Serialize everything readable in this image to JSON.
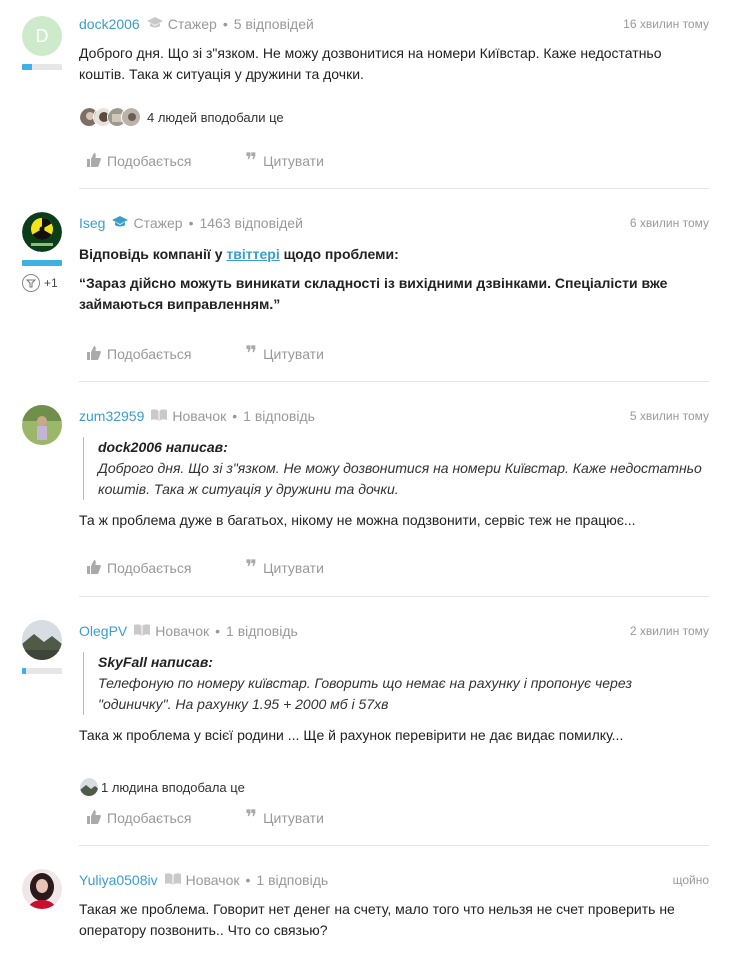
{
  "like_label": "Подобається",
  "quote_label": "Цитувати",
  "posts": [
    {
      "letter": "D",
      "username": "dock2006",
      "rank": "Стажер",
      "replies": "5 відповідей",
      "time": "16 хвилин тому",
      "rank_level": 0.25,
      "text": "Доброго дня. Що зі з\"язком. Не можу дозвонитися на номери Київстар. Каже недостатньо коштів. Така ж ситуація у дружини та дочки.",
      "likers_text": "4 людей вподобали це"
    },
    {
      "username": "Iseg",
      "rank": "Стажер",
      "replies": "1463 відповідей",
      "time": "6 хвилин тому",
      "rank_level": 1.0,
      "kudos": "+1",
      "line1_pre": "Відповідь компанії у ",
      "line1_link": "твіттері",
      "line1_post": " щодо проблеми:",
      "line2": "“Зараз дійсно можуть виникати складності із вихідними дзвінками. Спеціалісти вже займаються виправленням.”"
    },
    {
      "username": "zum32959",
      "rank": "Новачок",
      "replies": "1 відповідь",
      "time": "5 хвилин тому",
      "quote_author": "dock2006 написав:",
      "quote_text": "Доброго дня. Що зі з\"язком. Не можу дозвонитися на номери Київстар. Каже недостатньо коштів. Така ж ситуація у дружини та дочки.",
      "text": "Та ж проблема дуже в багатьох, нікому не можна подзвонити, сервіс теж не працює..."
    },
    {
      "username": "OlegPV",
      "rank": "Новачок",
      "replies": "1 відповідь",
      "time": "2 хвилин тому",
      "rank_level": 0.1,
      "quote_author": "SkyFall написав:",
      "quote_text": "Телефоную по номеру київстар. Говорить що немає на рахунку і пропонує через \"одиничку\". На рахунку 1.95 + 2000 мб і 57хв",
      "text": "Така ж проблема у всієї родини ... Ще й рахунок перевірити не дає видає помилку...",
      "likers_text": "1 людина вподобала це"
    },
    {
      "username": "Yuliya0508iv",
      "rank": "Новачок",
      "replies": "1 відповідь",
      "time": "щойно",
      "text": "Такая же проблема. Говорит нет денег на счету, мало того что нельзя не счет проверить не оператору позвонить.. Что со связью?"
    }
  ]
}
